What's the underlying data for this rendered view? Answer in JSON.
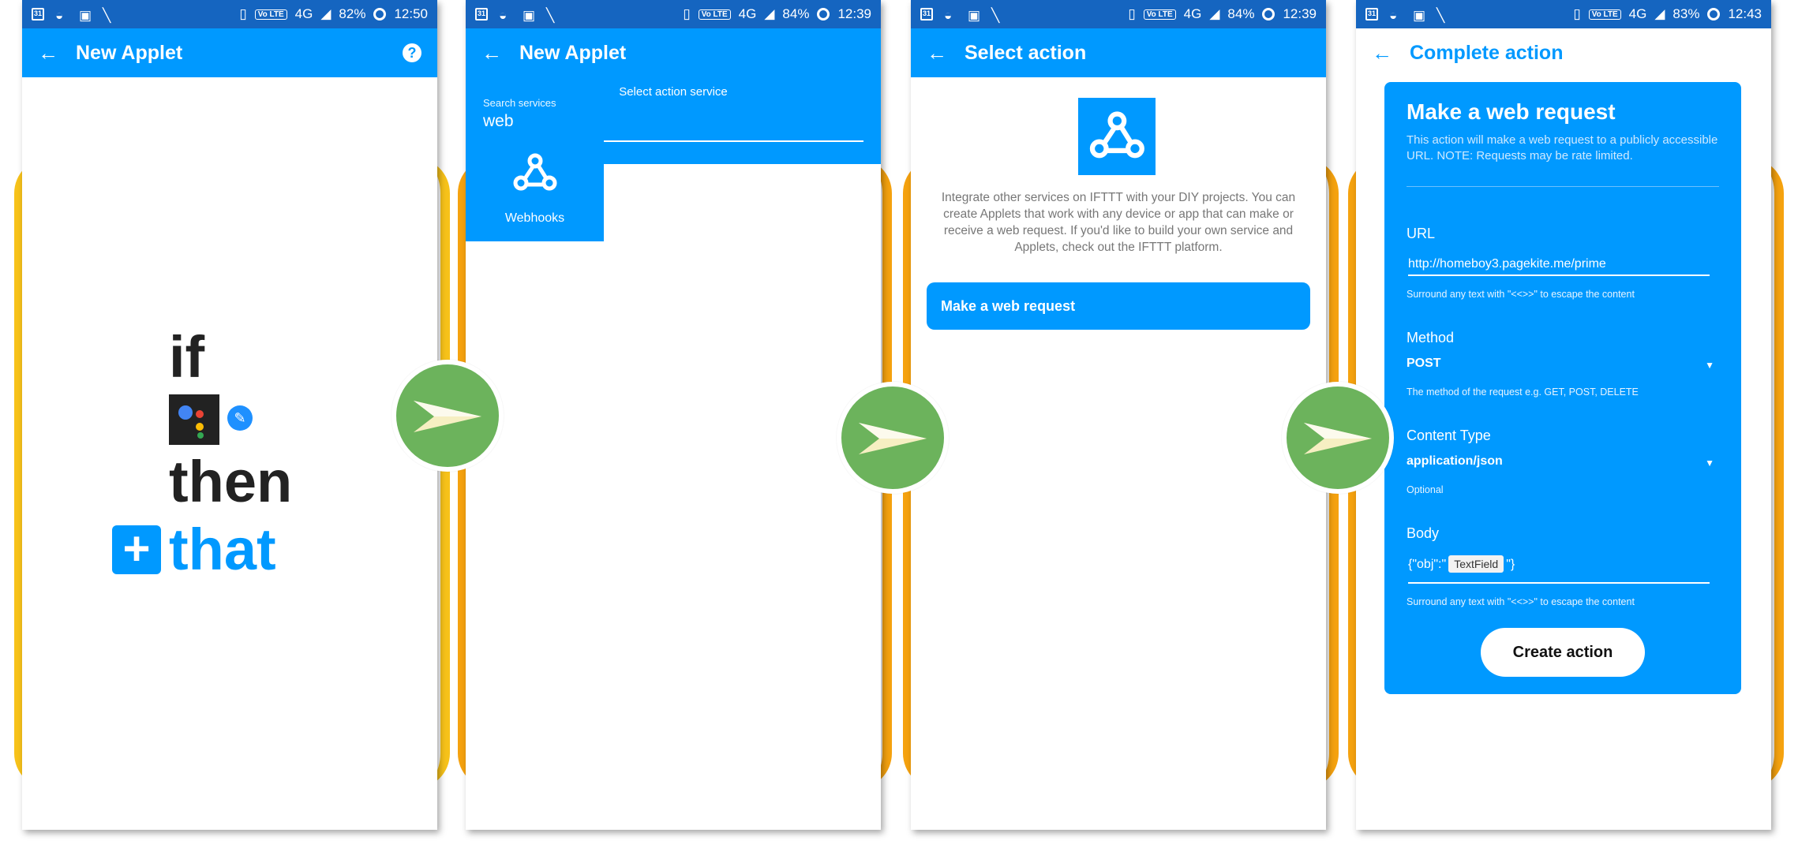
{
  "statusbars": [
    {
      "battery": "82%",
      "time": "12:50"
    },
    {
      "battery": "84%",
      "time": "12:39"
    },
    {
      "battery": "84%",
      "time": "12:39"
    },
    {
      "battery": "83%",
      "time": "12:43"
    }
  ],
  "status_common": {
    "calendar_day": "31",
    "lte": "Vo LTE",
    "network": "4G"
  },
  "colors": {
    "brand": "#0099ff",
    "statusbar": "#1565c0",
    "arrow": "#6cb35c",
    "rail_yellow": "#f7c21a",
    "rail_orange": "#f5a20f"
  },
  "icons": {
    "back": "back-arrow-icon",
    "help": "help-icon",
    "webhooks": "webhooks-icon",
    "next": "next-arrow-icon"
  },
  "phone1": {
    "title": "New Applet",
    "if_word": "if",
    "then_word": "then",
    "that_word": "that",
    "plus": "+"
  },
  "phone2": {
    "title": "New Applet",
    "subtitle": "Select action service",
    "search_label": "Search services",
    "search_value": "web",
    "tile_label": "Webhooks"
  },
  "phone3": {
    "title": "Select action",
    "description": "Integrate other services on IFTTT with your DIY projects. You can create Applets that work with any device or app that can make or receive a web request. If you'd like to build your own service and Applets, check out the IFTTT platform.",
    "action_button": "Make a web request"
  },
  "phone4": {
    "title": "Complete action",
    "card_title": "Make a web request",
    "card_description": "This action will make a web request to a publicly accessible URL. NOTE: Requests may be rate limited.",
    "url_label": "URL",
    "url_value": "http://homeboy3.pagekite.me/prime",
    "url_help": "Surround any text with \"<<>>\" to escape the content",
    "method_label": "Method",
    "method_value": "POST",
    "method_help": "The method of the request e.g. GET, POST, DELETE",
    "content_label": "Content Type",
    "content_value": "application/json",
    "content_help": "Optional",
    "body_label": "Body",
    "body_prefix": "{\"obj\":\"",
    "body_ingredient": "TextField",
    "body_suffix": "\"}",
    "body_help": "Surround any text with \"<<>>\" to escape the content",
    "create_button": "Create action"
  }
}
